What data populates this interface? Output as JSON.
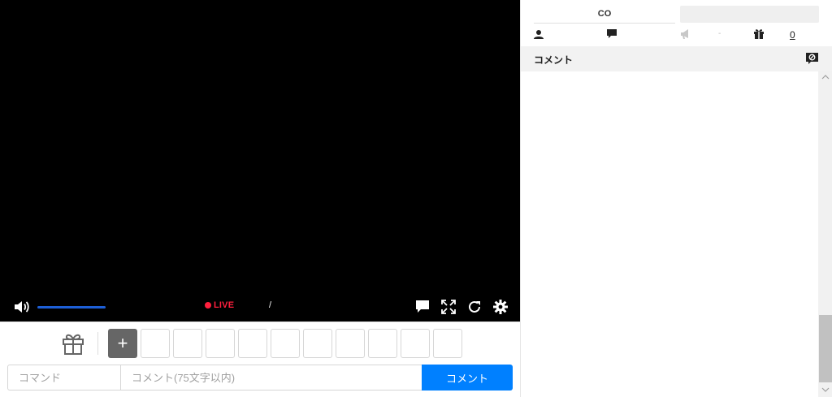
{
  "player": {
    "live_label": "LIVE",
    "time_separator": "/",
    "volume_level": 1.0,
    "icons": {
      "volume": "volume-icon",
      "comment": "comment-bubble-icon",
      "fullscreen": "fullscreen-icon",
      "reload": "reload-icon",
      "settings": "gear-icon"
    },
    "colors": {
      "live": "#ff1f3d",
      "volume_bar": "#1d5fd6"
    }
  },
  "bottom": {
    "gift_icon": "gift-icon",
    "add_label": "+",
    "slot_count": 10,
    "command_placeholder": "コマンド",
    "comment_placeholder": "コメント(75文字以内)",
    "submit_label": "コメント",
    "colors": {
      "submit": "#0080ff"
    }
  },
  "side": {
    "community_label": "CO",
    "stats": {
      "viewer_icon": "person-icon",
      "comment_icon": "speech-bubble-icon",
      "ad_icon": "megaphone-icon",
      "ad_value": "-",
      "gift_icon": "gift-icon",
      "gift_count": "0"
    },
    "comment_header": "コメント",
    "hide_icon": "hide-comment-icon"
  }
}
